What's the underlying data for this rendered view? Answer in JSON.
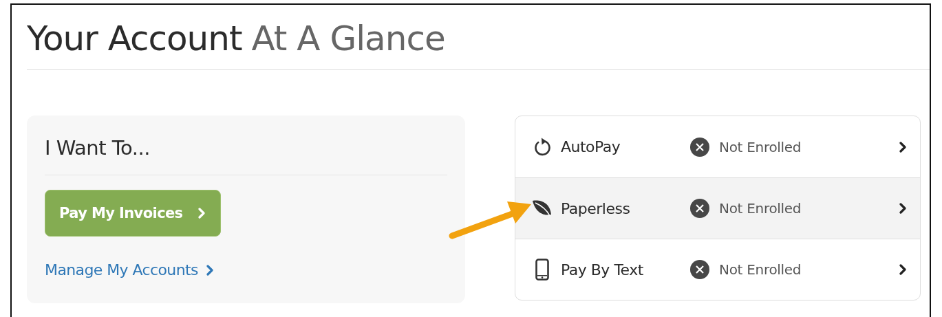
{
  "header": {
    "title": "Your Account",
    "title_accent": "At A Glance"
  },
  "actions": {
    "heading": "I Want To...",
    "primary_button": "Pay My Invoices",
    "link": "Manage My Accounts"
  },
  "services": [
    {
      "kind": "autopay",
      "name": "AutoPay",
      "status": "Not Enrolled",
      "enrolled": false,
      "highlighted": false
    },
    {
      "kind": "paperless",
      "name": "Paperless",
      "status": "Not Enrolled",
      "enrolled": false,
      "highlighted": true
    },
    {
      "kind": "text",
      "name": "Pay By Text",
      "status": "Not Enrolled",
      "enrolled": false,
      "highlighted": false
    }
  ],
  "annotation": {
    "kind": "arrow"
  }
}
